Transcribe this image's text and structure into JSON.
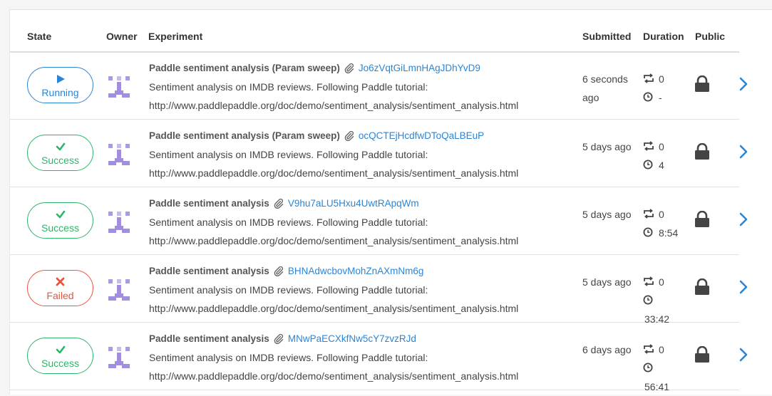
{
  "header": {
    "state": "State",
    "owner": "Owner",
    "experiment": "Experiment",
    "submitted": "Submitted",
    "duration": "Duration",
    "public": "Public"
  },
  "rows": [
    {
      "status": "Running",
      "status_type": "running",
      "title": "Paddle sentiment analysis (Param sweep)",
      "id": "Jo6zVqtGiLmnHAgJDhYvD9",
      "description": "Sentiment analysis on IMDB reviews. Following Paddle tutorial:",
      "url": "http://www.paddlepaddle.org/doc/demo/sentiment_analysis/sentiment_analysis.html",
      "submitted": "6 seconds ago",
      "retries": "0",
      "duration": "-"
    },
    {
      "status": "Success",
      "status_type": "success",
      "title": "Paddle sentiment analysis (Param sweep)",
      "id": "ocQCTEjHcdfwDToQaLBEuP",
      "description": "Sentiment analysis on IMDB reviews. Following Paddle tutorial:",
      "url": "http://www.paddlepaddle.org/doc/demo/sentiment_analysis/sentiment_analysis.html",
      "submitted": "5 days ago",
      "retries": "0",
      "duration": "4"
    },
    {
      "status": "Success",
      "status_type": "success",
      "title": "Paddle sentiment analysis",
      "id": "V9hu7aLU5Hxu4UwtRApqWm",
      "description": "Sentiment analysis on IMDB reviews. Following Paddle tutorial:",
      "url": "http://www.paddlepaddle.org/doc/demo/sentiment_analysis/sentiment_analysis.html",
      "submitted": "5 days ago",
      "retries": "0",
      "duration": "8:54"
    },
    {
      "status": "Failed",
      "status_type": "failed",
      "title": "Paddle sentiment analysis",
      "id": "BHNAdwcbovMohZnAXmNm6g",
      "description": "Sentiment analysis on IMDB reviews. Following Paddle tutorial:",
      "url": "http://www.paddlepaddle.org/doc/demo/sentiment_analysis/sentiment_analysis.html",
      "submitted": "5 days ago",
      "retries": "0",
      "duration": "33:42"
    },
    {
      "status": "Success",
      "status_type": "success",
      "title": "Paddle sentiment analysis",
      "id": "MNwPaECXkfNw5cY7zvzRJd",
      "description": "Sentiment analysis on IMDB reviews. Following Paddle tutorial:",
      "url": "http://www.paddlepaddle.org/doc/demo/sentiment_analysis/sentiment_analysis.html",
      "submitted": "6 days ago",
      "retries": "0",
      "duration": "56:41"
    }
  ],
  "icons": {
    "running": "play-icon",
    "success": "check-icon",
    "failed": "x-icon",
    "owner": "owner-avatar-icon",
    "attachment": "paperclip-icon",
    "retries": "retry-icon",
    "duration": "clock-icon",
    "public": "lock-icon",
    "open": "chevron-right-icon"
  },
  "colors": {
    "running": "#2b85d6",
    "success": "#2cb567",
    "failed": "#e8553d",
    "link": "#2b85d6",
    "avatar": "#a18ee0"
  }
}
